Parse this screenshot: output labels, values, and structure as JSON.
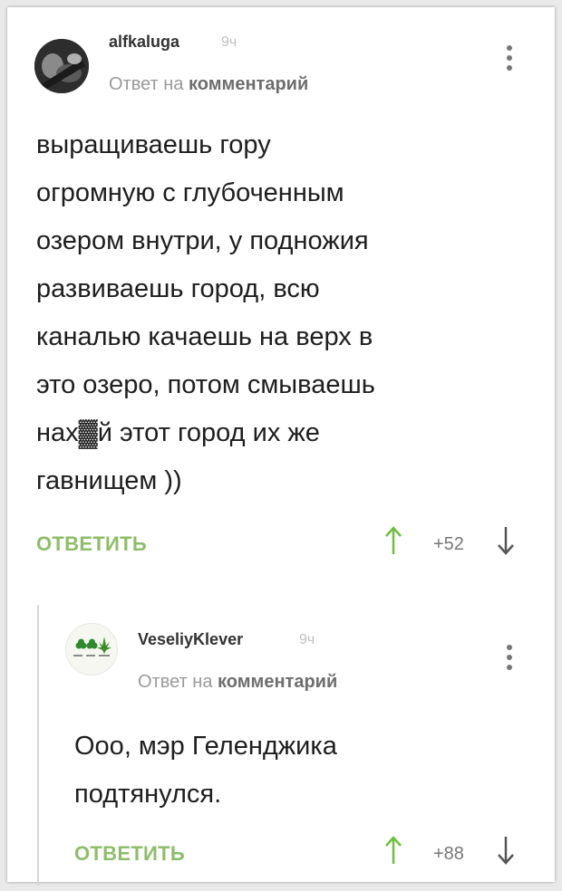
{
  "comment": {
    "username": "alfkaluga",
    "time": "9ч",
    "reply_prefix": "Ответ на",
    "reply_link": "комментарий",
    "text": "выращиваешь гору\nогромную с глубоченным\nозером внутри, у подножия\nразвиваешь город, всю\nканалью качаешь на верх в\nэто озеро, потом смываешь\nнах▓й этот город их же\nгавнищем ))",
    "reply_label": "ОТВЕТИТЬ",
    "score": "+52"
  },
  "reply": {
    "username": "VeseliyKlever",
    "time": "9ч",
    "reply_prefix": "Ответ на",
    "reply_link": "комментарий",
    "text": "Ооо, мэр Геленджика\nподтянулся.",
    "reply_label": "ОТВЕТИТЬ",
    "score": "+88"
  },
  "colors": {
    "accent_green": "#8ebd6a",
    "vote_up": "#6fbf3e",
    "vote_down": "#555555"
  },
  "icons": [
    "more-vertical-icon",
    "arrow-up-icon",
    "arrow-down-icon"
  ]
}
